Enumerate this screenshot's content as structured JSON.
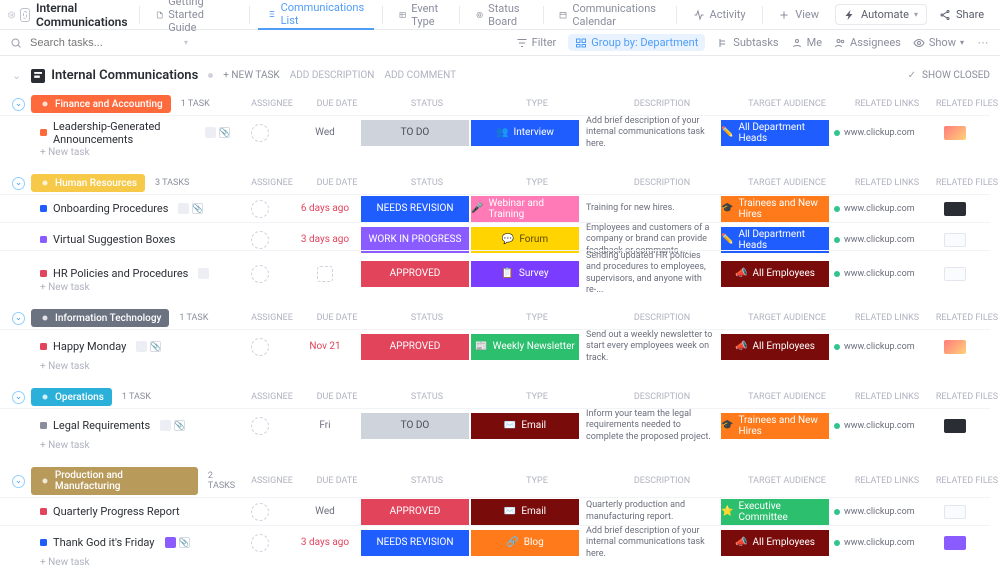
{
  "breadcrumb": "Internal Communications",
  "views": [
    {
      "icon": "doc",
      "label": "Getting Started Guide"
    },
    {
      "icon": "list",
      "label": "Communications List",
      "active": true
    },
    {
      "icon": "table",
      "label": "Event Type"
    },
    {
      "icon": "status",
      "label": "Status Board"
    },
    {
      "icon": "cal",
      "label": "Communications Calendar"
    },
    {
      "icon": "pulse",
      "label": "Activity"
    },
    {
      "icon": "plus",
      "label": "View"
    }
  ],
  "top_right": {
    "automate": "Automate",
    "share": "Share"
  },
  "search_placeholder": "Search tasks...",
  "filters": {
    "filter": "Filter",
    "group": "Group by: Department",
    "subtasks": "Subtasks",
    "me": "Me",
    "assignees": "Assignees",
    "show": "Show"
  },
  "list_title": "Internal Communications",
  "list_actions": {
    "new": "+ NEW TASK",
    "desc": "ADD DESCRIPTION",
    "comment": "ADD COMMENT"
  },
  "show_closed": "SHOW CLOSED",
  "columns": [
    "ASSIGNEE",
    "DUE DATE",
    "STATUS",
    "TYPE",
    "DESCRIPTION",
    "TARGET AUDIENCE",
    "RELATED LINKS",
    "RELATED FILES"
  ],
  "new_task_label": "+ New task",
  "type_icons": {
    "Interview": "👥",
    "Webinar and Training": "🎤",
    "Forum": "💬",
    "Survey": "📋",
    "Weekly Newsletter": "📰",
    "Email": "✉️",
    "Blog": "🔗"
  },
  "audience_icons": {
    "All Department Heads": "✏️",
    "Trainees and New Hires": "🎓",
    "All Employees": "📣",
    "Executive Committee": "⭐"
  },
  "groups": [
    {
      "name": "Finance and Accounting",
      "color": "#ff6a3d",
      "count": "1 TASK",
      "tasks": [
        {
          "sq": "#ff6a3d",
          "name": "Leadership-Generated Announcements",
          "minis": [
            "img",
            "clip"
          ],
          "due": "Wed",
          "due_over": false,
          "status": {
            "label": "TO DO",
            "bg": "#cfd3dc",
            "fg": "#4a4d59"
          },
          "type": {
            "label": "Interview",
            "bg": "#1f5dff"
          },
          "desc": "Add brief description of your internal communications task here.",
          "aud": {
            "label": "All Department Heads",
            "bg": "#1f5dff"
          },
          "link": "www.clickup.com",
          "file": "color"
        }
      ]
    },
    {
      "name": "Human Resources",
      "color": "#f7c948",
      "count": "3 TASKS",
      "tasks": [
        {
          "sq": "#1f5dff",
          "name": "Onboarding Procedures",
          "minis": [
            "img",
            "clip"
          ],
          "due": "6 days ago",
          "due_over": true,
          "status": {
            "label": "NEEDS REVISION",
            "bg": "#1f5dff"
          },
          "type": {
            "label": "Webinar and Training",
            "bg": "#ff7ab6"
          },
          "desc": "Training for new hires.",
          "aud": {
            "label": "Trainees and New Hires",
            "bg": "#ff7a1a"
          },
          "link": "www.clickup.com",
          "file": "dark"
        },
        {
          "sq": "#8a5cff",
          "name": "Virtual Suggestion Boxes",
          "minis": [],
          "due": "3 days ago",
          "due_over": true,
          "status": {
            "label": "WORK IN PROGRESS",
            "bg": "#8a5cff"
          },
          "type": {
            "label": "Forum",
            "bg": "#ffd400",
            "fg": "#5a4500"
          },
          "desc": "Employees and customers of a company or brand can provide feedback or comments ...",
          "aud": {
            "label": "All Department Heads",
            "bg": "#1f5dff"
          },
          "link": "www.clickup.com",
          "file": "blank"
        },
        {
          "sq": "#e2445c",
          "name": "HR Policies and Procedures",
          "minis": [
            "img"
          ],
          "due": "",
          "due_over": false,
          "status": {
            "label": "APPROVED",
            "bg": "#e2445c"
          },
          "type": {
            "label": "Survey",
            "bg": "#7a3cff"
          },
          "desc": "Sending updated HR policies and procedures to employees, supervisors, and anyone with re-...",
          "aud": {
            "label": "All Employees",
            "bg": "#7a0b0b"
          },
          "link": "www.clickup.com",
          "file": "blank"
        }
      ]
    },
    {
      "name": "Information Technology",
      "color": "#6b7280",
      "count": "1 TASK",
      "tasks": [
        {
          "sq": "#e2445c",
          "name": "Happy Monday",
          "minis": [
            "img",
            "clip"
          ],
          "due": "Nov 21",
          "due_over": true,
          "status": {
            "label": "APPROVED",
            "bg": "#e2445c"
          },
          "type": {
            "label": "Weekly Newsletter",
            "bg": "#2bbf6e"
          },
          "desc": "Send out a weekly newsletter to start every employees week on track.",
          "aud": {
            "label": "All Employees",
            "bg": "#7a0b0b"
          },
          "link": "www.clickup.com",
          "file": "color"
        }
      ]
    },
    {
      "name": "Operations",
      "color": "#2bb0d9",
      "count": "1 TASK",
      "tasks": [
        {
          "sq": "#8a8d9c",
          "name": "Legal Requirements",
          "minis": [
            "img",
            "clip"
          ],
          "due": "Fri",
          "due_over": false,
          "status": {
            "label": "TO DO",
            "bg": "#cfd3dc",
            "fg": "#4a4d59"
          },
          "type": {
            "label": "Email",
            "bg": "#7a0b0b"
          },
          "desc": "Inform your team the legal requirements needed to complete the proposed project.",
          "aud": {
            "label": "Trainees and New Hires",
            "bg": "#ff7a1a"
          },
          "link": "www.clickup.com",
          "file": "dark"
        }
      ]
    },
    {
      "name": "Production and Manufacturing",
      "color": "#b89a5b",
      "count": "2 TASKS",
      "tasks": [
        {
          "sq": "#e2445c",
          "name": "Quarterly Progress Report",
          "minis": [],
          "due": "Wed",
          "due_over": false,
          "status": {
            "label": "APPROVED",
            "bg": "#e2445c"
          },
          "type": {
            "label": "Email",
            "bg": "#7a0b0b"
          },
          "desc": "Quarterly production and manufacturing report.",
          "aud": {
            "label": "Executive Committee",
            "bg": "#2bbf6e"
          },
          "link": "www.clickup.com",
          "file": "blank"
        },
        {
          "sq": "#1f5dff",
          "name": "Thank God it's Friday",
          "minis": [
            "badge",
            "clip"
          ],
          "due": "3 days ago",
          "due_over": true,
          "status": {
            "label": "NEEDS REVISION",
            "bg": "#1f5dff"
          },
          "type": {
            "label": "Blog",
            "bg": "#ff7a1a"
          },
          "desc": "Add brief description of your internal communications task here.",
          "aud": {
            "label": "All Employees",
            "bg": "#7a0b0b"
          },
          "link": "www.clickup.com",
          "file": "purple"
        }
      ]
    }
  ]
}
